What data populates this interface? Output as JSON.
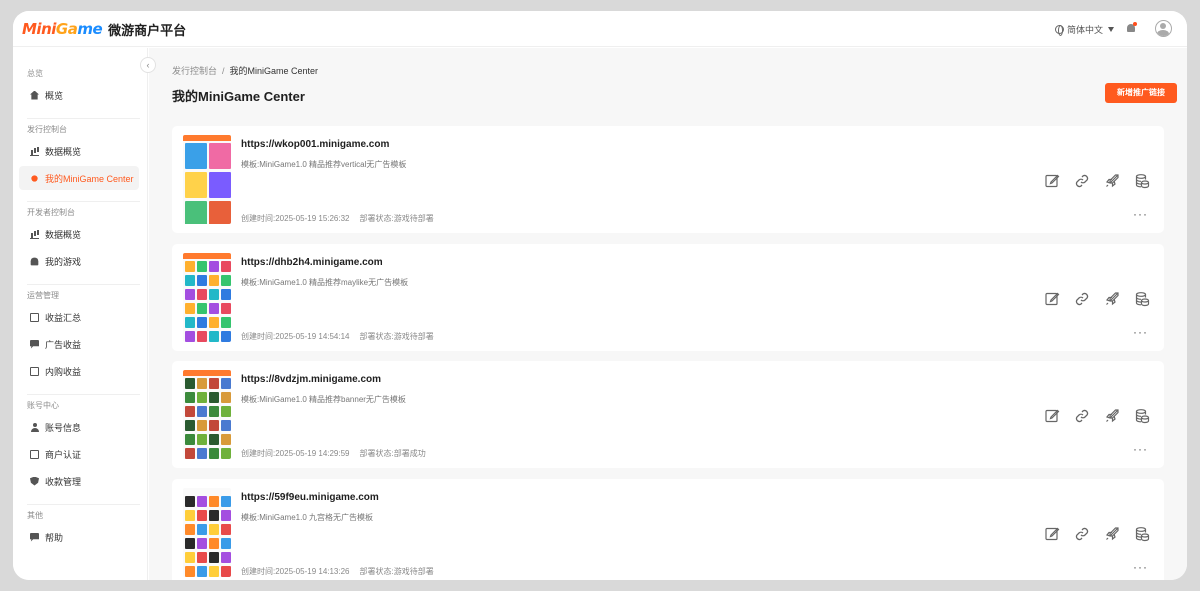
{
  "app": {
    "logo_part1": "Mini",
    "logo_part2": "Ga",
    "logo_part3": "me",
    "platform_name": "微游商户平台"
  },
  "header": {
    "language": "简体中文"
  },
  "sidebar": {
    "groups": [
      {
        "title": "总览",
        "items": [
          {
            "label": "概览",
            "icon": "home-icon"
          }
        ]
      },
      {
        "title": "发行控制台",
        "items": [
          {
            "label": "数据概览",
            "icon": "bar-chart-icon"
          },
          {
            "label": "我的MiniGame Center",
            "icon": "share-icon",
            "active": true
          }
        ]
      },
      {
        "title": "开发者控制台",
        "items": [
          {
            "label": "数据概览",
            "icon": "bar-chart-icon"
          },
          {
            "label": "我的游戏",
            "icon": "bell-icon"
          }
        ]
      },
      {
        "title": "运营管理",
        "items": [
          {
            "label": "收益汇总",
            "icon": "document-icon"
          },
          {
            "label": "广告收益",
            "icon": "message-icon"
          },
          {
            "label": "内购收益",
            "icon": "document-icon"
          }
        ]
      },
      {
        "title": "账号中心",
        "items": [
          {
            "label": "账号信息",
            "icon": "user-icon"
          },
          {
            "label": "商户认证",
            "icon": "card-icon"
          },
          {
            "label": "收款管理",
            "icon": "shield-icon"
          }
        ]
      },
      {
        "title": "其他",
        "items": [
          {
            "label": "帮助",
            "icon": "message-icon"
          }
        ]
      }
    ]
  },
  "main": {
    "breadcrumb": {
      "parent": "发行控制台",
      "separator": "/",
      "current": "我的MiniGame Center"
    },
    "title": "我的MiniGame Center",
    "new_button": "新增推广链接",
    "cards": [
      {
        "url": "https://wkop001.minigame.com",
        "template": "模板:MiniGame1.0 精品推荐vertical无广告模板",
        "created": "创建时间:2025-05-19 15:26:32",
        "status": "部署状态:游戏待部署"
      },
      {
        "url": "https://dhb2h4.minigame.com",
        "template": "模板:MiniGame1.0 精品推荐maylike无广告模板",
        "created": "创建时间:2025-05-19 14:54:14",
        "status": "部署状态:游戏待部署"
      },
      {
        "url": "https://8vdzjm.minigame.com",
        "template": "模板:MiniGame1.0 精品推荐banner无广告模板",
        "created": "创建时间:2025-05-19 14:29:59",
        "status": "部署状态:部署成功"
      },
      {
        "url": "https://59f9eu.minigame.com",
        "template": "模板:MiniGame1.0 九宫格无广告模板",
        "created": "创建时间:2025-05-19 14:13:26",
        "status": "部署状态:游戏待部署"
      }
    ],
    "card_actions": [
      "edit-icon",
      "link-icon",
      "rocket-icon",
      "coins-icon"
    ],
    "more_label": "···"
  },
  "colors": {
    "accent": "#ff5a1f",
    "background": "#f7f7f7"
  }
}
